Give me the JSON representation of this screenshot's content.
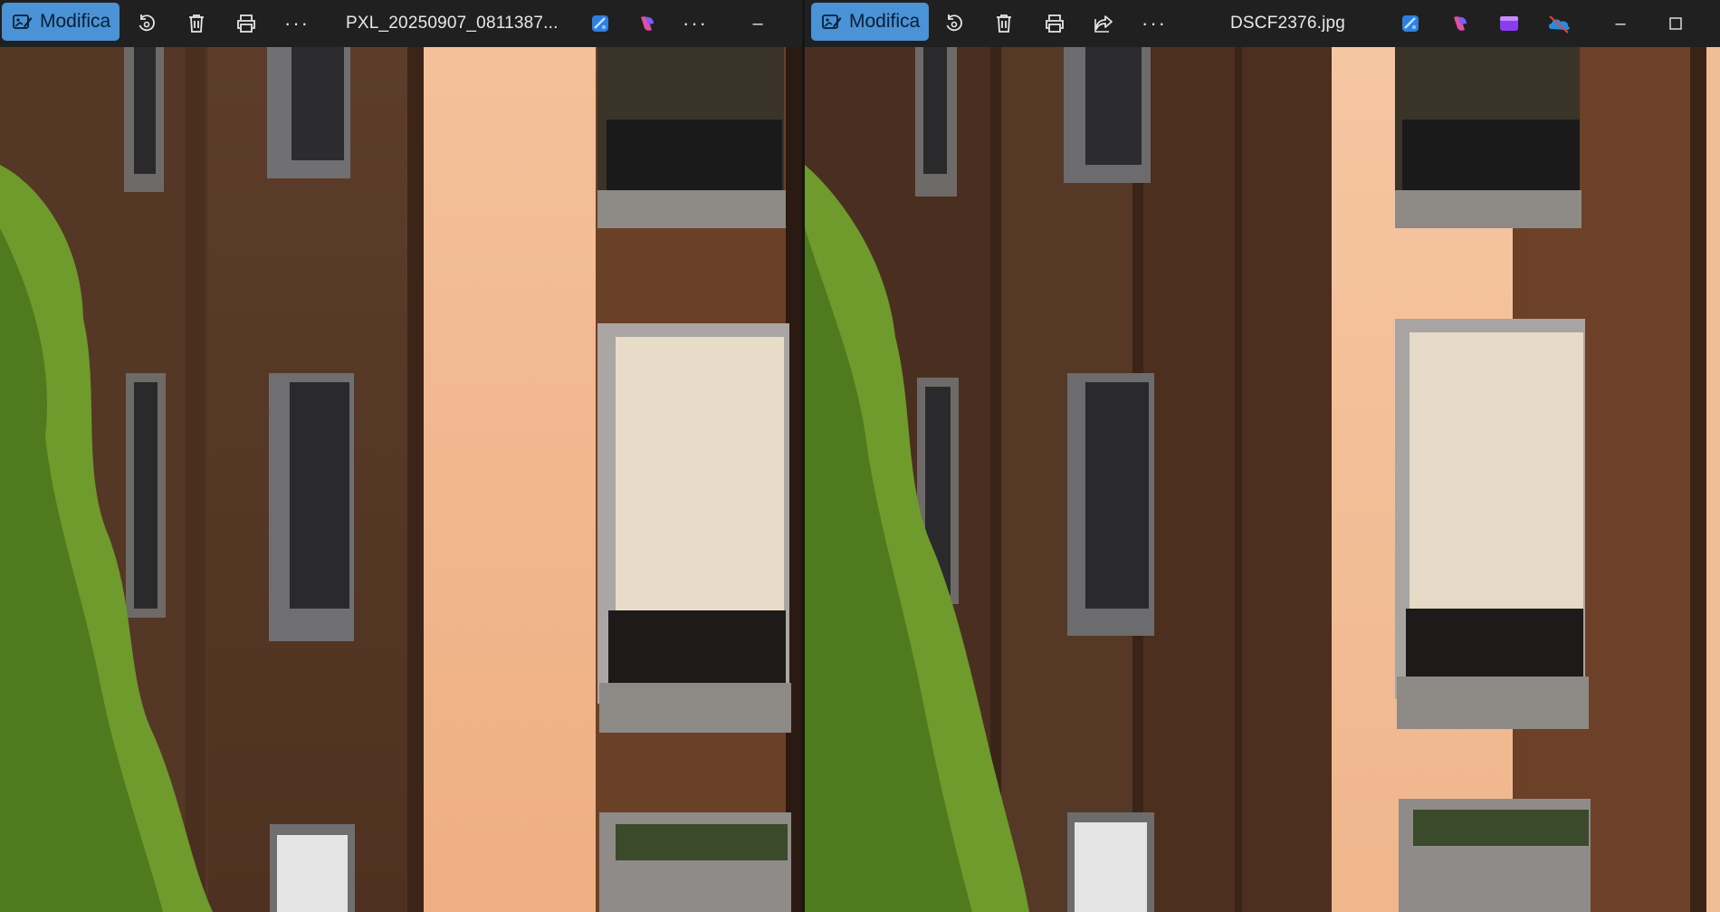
{
  "left_viewer": {
    "edit_label": "Modifica",
    "file_name": "PXL_20250907_0811387...",
    "more_label": "···",
    "minimize_label": "–",
    "icons": [
      "edit-icon",
      "rotate-icon",
      "delete-icon",
      "print-icon",
      "more-icon",
      "photos-app-icon",
      "copilot-icon",
      "more-icon",
      "minimize-icon"
    ]
  },
  "right_viewer": {
    "edit_label": "Modifica",
    "file_name": "DSCF2376.jpg",
    "more_label": "···",
    "minimize_label": "–",
    "icons": [
      "edit-icon",
      "rotate-icon",
      "delete-icon",
      "print-icon",
      "share-icon",
      "more-icon",
      "photos-app-icon",
      "copilot-icon",
      "clipchamp-icon",
      "onedrive-offline-icon",
      "minimize-icon",
      "maximize-icon"
    ]
  },
  "colors": {
    "toolbar_bg": "#202020",
    "accent": "#4a93d6",
    "wall_brown": "#5a3a28",
    "wall_peach": "#f2b98e",
    "foliage": "#6f9a2c"
  }
}
